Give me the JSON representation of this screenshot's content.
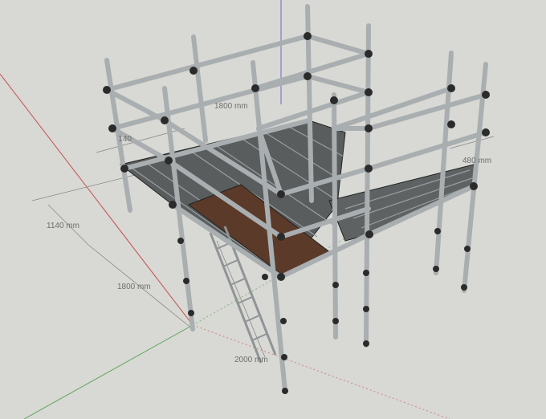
{
  "model": {
    "description_labels": {
      "dim_top": "1800 mm",
      "dim_left_partial": "1140 mm",
      "dim_height": "1140 mm",
      "dim_front": "1800 mm",
      "dim_ladder": "2000 mm",
      "dim_right": "480 mm"
    },
    "colors": {
      "background": "#d8d8d4",
      "tube": "#a9aeb0",
      "tube_edge": "#2b2b2b",
      "deck": "#5a5d5e",
      "board": "#5b3a2a",
      "axis_red": "#c85050",
      "axis_green": "#5aa65a",
      "axis_blue": "#6a6ad0"
    }
  }
}
